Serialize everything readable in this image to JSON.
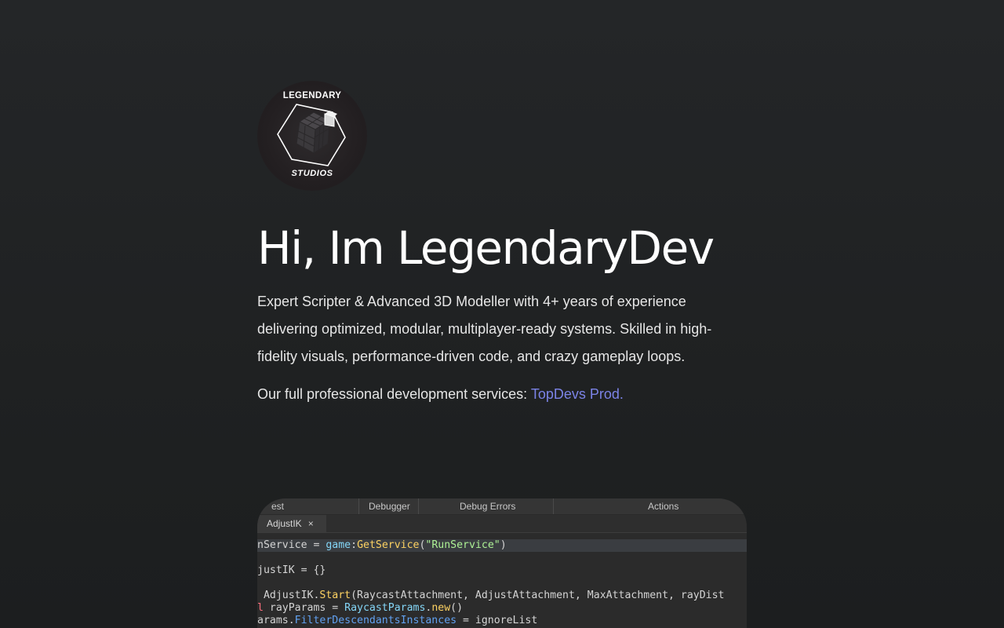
{
  "logo": {
    "top_text": "LEGENDARY",
    "bottom_text": "STUDIOS",
    "icon": "cube-logo-icon"
  },
  "hero": {
    "title": "Hi, Im LegendaryDev",
    "bio": "Expert Scripter & Advanced 3D Modeller with 4+ years of experience delivering optimized, modular, multiplayer-ready systems. Skilled in high-fidelity visuals, performance-driven code, and crazy gameplay loops.",
    "services_prefix": "Our full professional development services: ",
    "services_link": "TopDevs Prod."
  },
  "code_preview": {
    "tabs": [
      "est",
      "Debugger",
      "Debug Errors",
      "Actions"
    ],
    "doc_tab": "AdjustIK",
    "doc_tab_close": "×",
    "lines": [
      {
        "a": "nService = ",
        "b": "game",
        "c": ":",
        "d": "GetService",
        "e": "(",
        "f": "\"RunService\"",
        "g": ")"
      },
      {
        "text": "justIK = {}"
      },
      {
        "a": " AdjustIK.",
        "b": "Start",
        "c": "(RaycastAttachment, AdjustAttachment, MaxAttachment, rayDist"
      },
      {
        "a": "l",
        "b": " rayParams = ",
        "c": "RaycastParams",
        "d": ".",
        "e": "new",
        "f": "()"
      },
      {
        "a": "arams.",
        "b": "FilterDescendantsInstances",
        "c": " = ignoreList"
      }
    ]
  },
  "colors": {
    "link": "#7b83e6",
    "background": "#232526"
  }
}
